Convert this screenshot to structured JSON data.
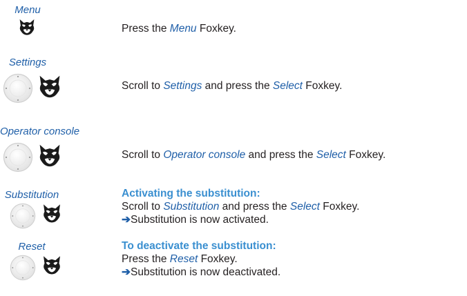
{
  "steps": [
    {
      "label": "Menu",
      "icons": [
        "fox-icon"
      ],
      "lines": [
        {
          "parts": [
            [
              "t",
              "Press the "
            ],
            [
              "k",
              "Menu"
            ],
            [
              "t",
              " Foxkey."
            ]
          ]
        }
      ]
    },
    {
      "label": "Settings",
      "icons": [
        "navigation-key-icon",
        "fox-icon"
      ],
      "lines": [
        {
          "parts": [
            [
              "t",
              "Scroll to "
            ],
            [
              "k",
              "Settings"
            ],
            [
              "t",
              " and press the "
            ],
            [
              "k",
              "Select"
            ],
            [
              "t",
              " Foxkey."
            ]
          ]
        }
      ]
    },
    {
      "label": "Operator console",
      "icons": [
        "navigation-key-icon",
        "fox-icon"
      ],
      "lines": [
        {
          "parts": [
            [
              "t",
              "Scroll to "
            ],
            [
              "k",
              "Operator console"
            ],
            [
              "t",
              " and press the "
            ],
            [
              "k",
              "Select"
            ],
            [
              "t",
              " Foxkey."
            ]
          ]
        }
      ]
    },
    {
      "label": "Substitution",
      "icons": [
        "navigation-key-icon",
        "fox-icon"
      ],
      "lines": [
        {
          "parts": [
            [
              "h",
              "Activating the substitution:"
            ]
          ]
        },
        {
          "parts": [
            [
              "t",
              "Scroll to "
            ],
            [
              "k",
              "Substitution"
            ],
            [
              "t",
              " and press the "
            ],
            [
              "k",
              "Select"
            ],
            [
              "t",
              " Foxkey."
            ]
          ]
        },
        {
          "parts": [
            [
              "a",
              "➔"
            ],
            [
              "t",
              "Substitution is now activated."
            ]
          ]
        }
      ]
    },
    {
      "label": "Reset",
      "icons": [
        "navigation-key-icon",
        "fox-icon"
      ],
      "lines": [
        {
          "parts": [
            [
              "h",
              "To deactivate the substitution:"
            ]
          ]
        },
        {
          "parts": [
            [
              "t",
              "Press the "
            ],
            [
              "k",
              "Reset"
            ],
            [
              "t",
              " Foxkey."
            ]
          ]
        },
        {
          "parts": [
            [
              "a",
              "➔"
            ],
            [
              "t",
              "Substitution is now deactivated."
            ]
          ]
        }
      ]
    }
  ]
}
